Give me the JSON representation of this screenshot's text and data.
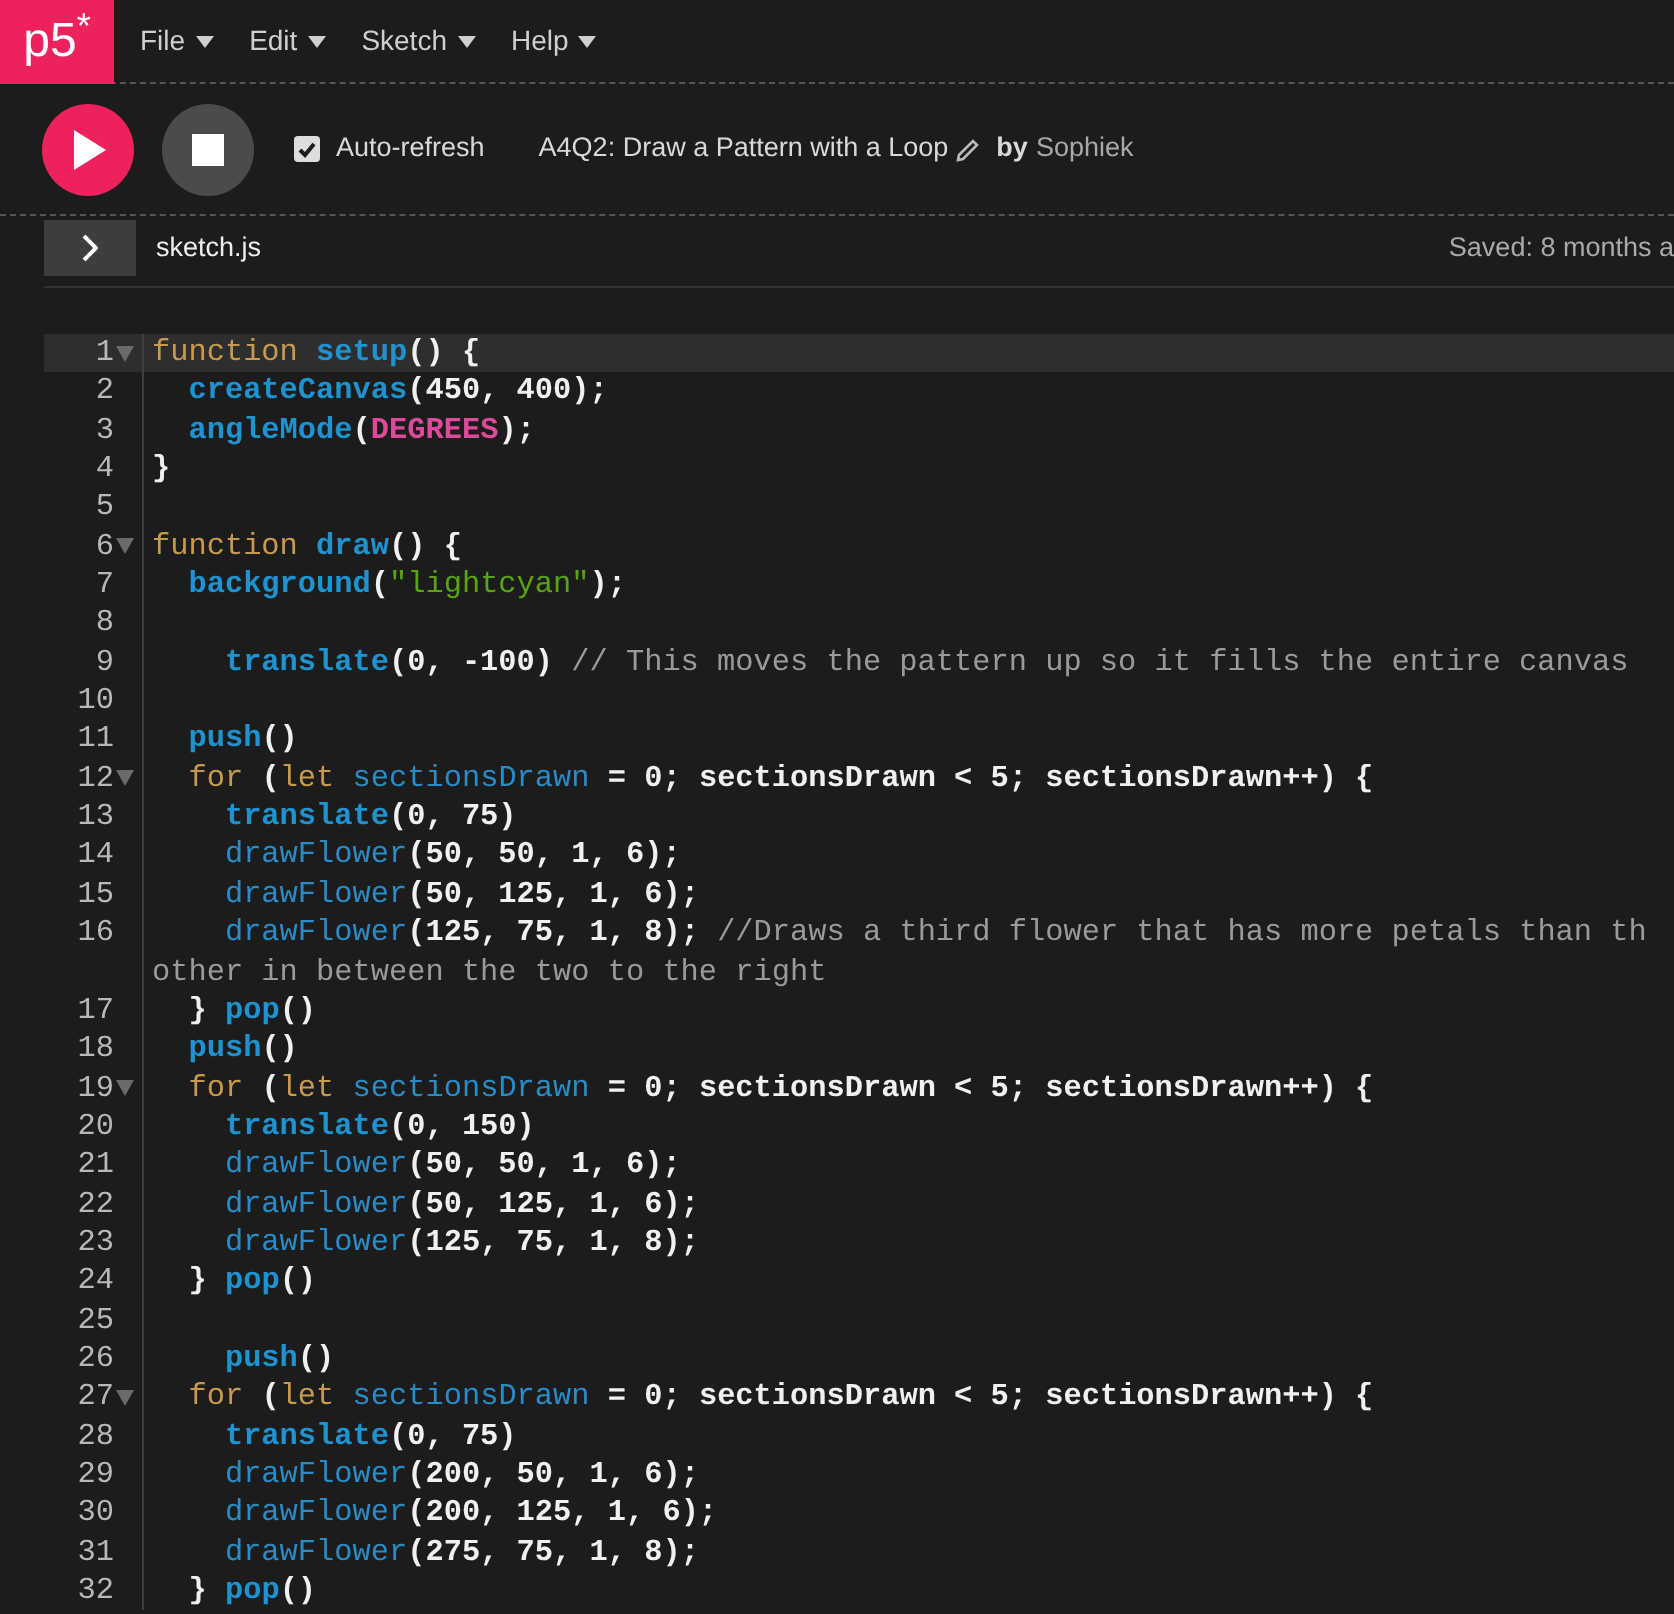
{
  "logo": "p5$^{*}$",
  "menu": [
    "File",
    "Edit",
    "Sketch",
    "Help"
  ],
  "toolbar": {
    "auto_refresh": {
      "label": "Auto-refresh",
      "checked": true
    },
    "sketch_title": "A4Q2: Draw a Pattern with a Loop",
    "by": "by",
    "author": "Sophiek"
  },
  "file_bar": {
    "file_name": "sketch.js",
    "saved_status": "Saved: 8 months a"
  },
  "editor": {
    "lines": [
      {
        "number": "1",
        "foldable": true,
        "active": true,
        "tokens": [
          {
            "kind": "keyword",
            "text": "function "
          },
          {
            "kind": "builtin",
            "text": "setup"
          },
          {
            "kind": "plain",
            "text": "() {"
          }
        ]
      },
      {
        "number": "2",
        "foldable": false,
        "active": false,
        "tokens": [
          {
            "kind": "builtin",
            "text": "  createCanvas"
          },
          {
            "kind": "plain",
            "text": "(450, 400);"
          }
        ]
      },
      {
        "number": "3",
        "foldable": false,
        "active": false,
        "tokens": [
          {
            "kind": "builtin",
            "text": "  angleMode"
          },
          {
            "kind": "plain",
            "text": "("
          },
          {
            "kind": "constant",
            "text": "DEGREES"
          },
          {
            "kind": "plain",
            "text": ");"
          }
        ]
      },
      {
        "number": "4",
        "foldable": false,
        "active": false,
        "tokens": [
          {
            "kind": "plain",
            "text": "}"
          }
        ]
      },
      {
        "number": "5",
        "foldable": false,
        "active": false
      },
      {
        "number": "6",
        "foldable": true,
        "active": false,
        "tokens": [
          {
            "kind": "keyword",
            "text": "function "
          },
          {
            "kind": "builtin",
            "text": "draw"
          },
          {
            "kind": "plain",
            "text": "() {"
          }
        ]
      },
      {
        "number": "7",
        "foldable": false,
        "active": false,
        "tokens": [
          {
            "kind": "builtin",
            "text": "  background"
          },
          {
            "kind": "plain",
            "text": "("
          },
          {
            "kind": "string",
            "text": "\"lightcyan\""
          },
          {
            "kind": "plain",
            "text": ");"
          }
        ]
      },
      {
        "number": "8",
        "foldable": false,
        "active": false
      },
      {
        "number": "9",
        "foldable": false,
        "active": false,
        "tokens": [
          {
            "kind": "builtin",
            "text": "    translate"
          },
          {
            "kind": "plain",
            "text": "(0, -100) "
          },
          {
            "kind": "comment",
            "text": "// This moves the pattern up so it fills the entire canvas"
          }
        ]
      },
      {
        "number": "10",
        "foldable": false,
        "active": false
      },
      {
        "number": "11",
        "foldable": false,
        "active": false,
        "tokens": [
          {
            "kind": "builtin",
            "text": "  push"
          },
          {
            "kind": "plain",
            "text": "()"
          }
        ]
      },
      {
        "number": "12",
        "foldable": true,
        "active": false,
        "tokens": [
          {
            "kind": "keyword",
            "text": "  for"
          },
          {
            "kind": "plain",
            "text": " ("
          },
          {
            "kind": "keyword",
            "text": "let "
          },
          {
            "kind": "name",
            "text": "sectionsDrawn"
          },
          {
            "kind": "plain",
            "text": " = 0; sectionsDrawn < 5; sectionsDrawn++) {"
          }
        ]
      },
      {
        "number": "13",
        "foldable": false,
        "active": false,
        "tokens": [
          {
            "kind": "builtin",
            "text": "    translate"
          },
          {
            "kind": "plain",
            "text": "(0, 75)"
          }
        ]
      },
      {
        "number": "14",
        "foldable": false,
        "active": false,
        "tokens": [
          {
            "kind": "name",
            "text": "    drawFlower"
          },
          {
            "kind": "plain",
            "text": "(50, 50, 1, 6);"
          }
        ]
      },
      {
        "number": "15",
        "foldable": false,
        "active": false,
        "tokens": [
          {
            "kind": "name",
            "text": "    drawFlower"
          },
          {
            "kind": "plain",
            "text": "(50, 125, 1, 6);"
          }
        ]
      },
      {
        "number": "16",
        "foldable": false,
        "active": false,
        "tokens": [
          {
            "kind": "name",
            "text": "    drawFlower"
          },
          {
            "kind": "plain",
            "text": "(125, 75, 1, 8); "
          },
          {
            "kind": "comment",
            "text": "//Draws a third flower that has more petals than th"
          }
        ],
        "continuation": [
          {
            "kind": "comment",
            "text": "other in between the two to the right"
          }
        ]
      },
      {
        "number": "17",
        "foldable": false,
        "active": false,
        "tokens": [
          {
            "kind": "plain",
            "text": "  } "
          },
          {
            "kind": "builtin",
            "text": "pop"
          },
          {
            "kind": "plain",
            "text": "()"
          }
        ]
      },
      {
        "number": "18",
        "foldable": false,
        "active": false,
        "tokens": [
          {
            "kind": "builtin",
            "text": "  push"
          },
          {
            "kind": "plain",
            "text": "()"
          }
        ]
      },
      {
        "number": "19",
        "foldable": true,
        "active": false,
        "tokens": [
          {
            "kind": "keyword",
            "text": "  for"
          },
          {
            "kind": "plain",
            "text": " ("
          },
          {
            "kind": "keyword",
            "text": "let "
          },
          {
            "kind": "name",
            "text": "sectionsDrawn"
          },
          {
            "kind": "plain",
            "text": " = 0; sectionsDrawn < 5; sectionsDrawn++) {"
          }
        ]
      },
      {
        "number": "20",
        "foldable": false,
        "active": false,
        "tokens": [
          {
            "kind": "builtin",
            "text": "    translate"
          },
          {
            "kind": "plain",
            "text": "(0, 150)"
          }
        ]
      },
      {
        "number": "21",
        "foldable": false,
        "active": false,
        "tokens": [
          {
            "kind": "name",
            "text": "    drawFlower"
          },
          {
            "kind": "plain",
            "text": "(50, 50, 1, 6);"
          }
        ]
      },
      {
        "number": "22",
        "foldable": false,
        "active": false,
        "tokens": [
          {
            "kind": "name",
            "text": "    drawFlower"
          },
          {
            "kind": "plain",
            "text": "(50, 125, 1, 6);"
          }
        ]
      },
      {
        "number": "23",
        "foldable": false,
        "active": false,
        "tokens": [
          {
            "kind": "name",
            "text": "    drawFlower"
          },
          {
            "kind": "plain",
            "text": "(125, 75, 1, 8);"
          }
        ]
      },
      {
        "number": "24",
        "foldable": false,
        "active": false,
        "tokens": [
          {
            "kind": "plain",
            "text": "  } "
          },
          {
            "kind": "builtin",
            "text": "pop"
          },
          {
            "kind": "plain",
            "text": "()"
          }
        ]
      },
      {
        "number": "25",
        "foldable": false,
        "active": false
      },
      {
        "number": "26",
        "foldable": false,
        "active": false,
        "tokens": [
          {
            "kind": "builtin",
            "text": "    push"
          },
          {
            "kind": "plain",
            "text": "()"
          }
        ]
      },
      {
        "number": "27",
        "foldable": true,
        "active": false,
        "tokens": [
          {
            "kind": "keyword",
            "text": "  for"
          },
          {
            "kind": "plain",
            "text": " ("
          },
          {
            "kind": "keyword",
            "text": "let "
          },
          {
            "kind": "name",
            "text": "sectionsDrawn"
          },
          {
            "kind": "plain",
            "text": " = 0; sectionsDrawn < 5; sectionsDrawn++) {"
          }
        ]
      },
      {
        "number": "28",
        "foldable": false,
        "active": false,
        "tokens": [
          {
            "kind": "builtin",
            "text": "    translate"
          },
          {
            "kind": "plain",
            "text": "(0, 75)"
          }
        ]
      },
      {
        "number": "29",
        "foldable": false,
        "active": false,
        "tokens": [
          {
            "kind": "name",
            "text": "    drawFlower"
          },
          {
            "kind": "plain",
            "text": "(200, 50, 1, 6);"
          }
        ]
      },
      {
        "number": "30",
        "foldable": false,
        "active": false,
        "tokens": [
          {
            "kind": "name",
            "text": "    drawFlower"
          },
          {
            "kind": "plain",
            "text": "(200, 125, 1, 6);"
          }
        ]
      },
      {
        "number": "31",
        "foldable": false,
        "active": false,
        "tokens": [
          {
            "kind": "name",
            "text": "    drawFlower"
          },
          {
            "kind": "plain",
            "text": "(275, 75, 1, 8);"
          }
        ]
      },
      {
        "number": "32",
        "foldable": false,
        "active": false,
        "tokens": [
          {
            "kind": "plain",
            "text": "  } "
          },
          {
            "kind": "builtin",
            "text": "pop"
          },
          {
            "kind": "plain",
            "text": "()"
          }
        ]
      }
    ]
  }
}
